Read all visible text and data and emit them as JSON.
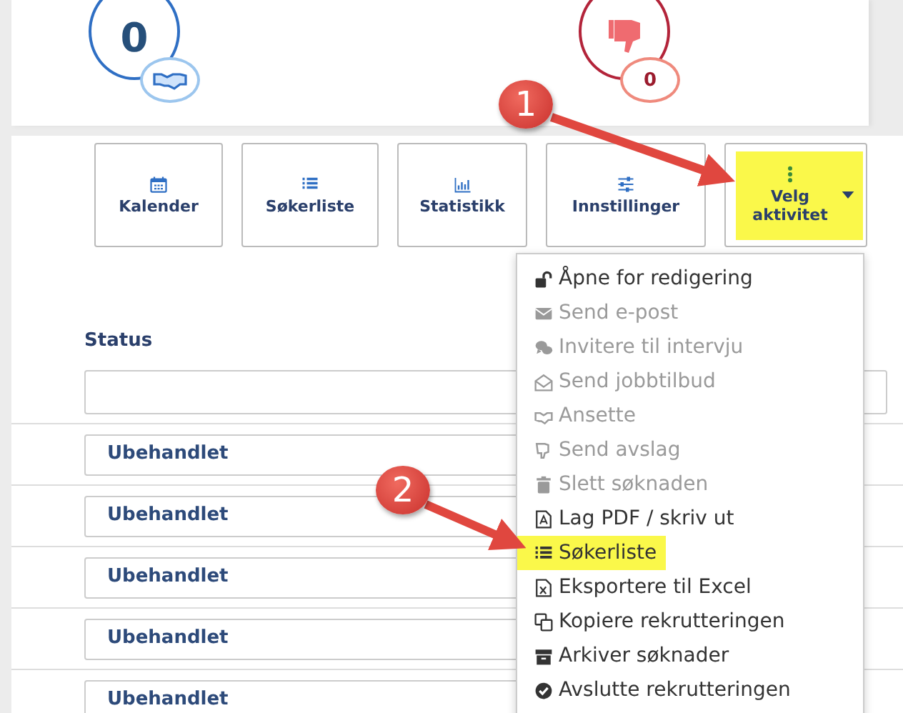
{
  "counters": [
    {
      "kind": "hired",
      "value": "0"
    },
    {
      "kind": "rejected",
      "value": "0"
    }
  ],
  "toolbar": [
    {
      "label": "Kalender",
      "kind": "calendar",
      "dropdown": false,
      "highlighted": false
    },
    {
      "label": "Søkerliste",
      "kind": "list",
      "dropdown": false,
      "highlighted": false
    },
    {
      "label": "Statistikk",
      "kind": "chart",
      "dropdown": false,
      "highlighted": false
    },
    {
      "label": "Innstillinger",
      "kind": "sliders",
      "dropdown": false,
      "highlighted": false
    },
    {
      "label": "Velg aktivitet",
      "kind": "dots",
      "dropdown": true,
      "highlighted": true
    }
  ],
  "table": {
    "columns": [
      "Status"
    ],
    "rows": [
      {
        "status": "Ubehandlet"
      },
      {
        "status": "Ubehandlet"
      },
      {
        "status": "Ubehandlet"
      },
      {
        "status": "Ubehandlet"
      },
      {
        "status": "Ubehandlet"
      }
    ]
  },
  "menu": {
    "items": [
      {
        "label": "Åpne for redigering",
        "kind": "unlock",
        "disabled": false,
        "highlighted": false
      },
      {
        "label": "Send e-post",
        "kind": "envelope",
        "disabled": true,
        "highlighted": false
      },
      {
        "label": "Invitere til intervju",
        "kind": "comments",
        "disabled": true,
        "highlighted": false
      },
      {
        "label": "Send jobbtilbud",
        "kind": "envelope-open",
        "disabled": true,
        "highlighted": false
      },
      {
        "label": "Ansette",
        "kind": "handshake",
        "disabled": true,
        "highlighted": false
      },
      {
        "label": "Send avslag",
        "kind": "thumbs-down",
        "disabled": true,
        "highlighted": false
      },
      {
        "label": "Slett søknaden",
        "kind": "trash",
        "disabled": true,
        "highlighted": false
      },
      {
        "label": "Lag PDF / skriv ut",
        "kind": "pdf",
        "disabled": false,
        "highlighted": false
      },
      {
        "label": "Søkerliste",
        "kind": "list",
        "disabled": false,
        "highlighted": true
      },
      {
        "label": "Eksportere til Excel",
        "kind": "excel",
        "disabled": false,
        "highlighted": false
      },
      {
        "label": "Kopiere rekrutteringen",
        "kind": "copy",
        "disabled": false,
        "highlighted": false
      },
      {
        "label": "Arkiver søknader",
        "kind": "archive",
        "disabled": false,
        "highlighted": false
      },
      {
        "label": "Avslutte rekrutteringen",
        "kind": "check-circle",
        "disabled": false,
        "highlighted": false
      }
    ]
  },
  "annotations": [
    {
      "number": "1"
    },
    {
      "number": "2"
    }
  ]
}
